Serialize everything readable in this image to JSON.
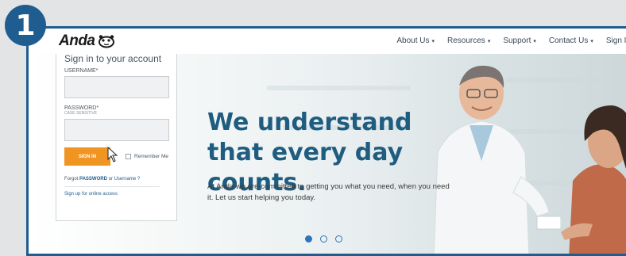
{
  "step": {
    "number": "1"
  },
  "nav": {
    "logo": "Anda",
    "items": [
      {
        "label": "About Us",
        "caret": "▾"
      },
      {
        "label": "Resources",
        "caret": "▾"
      },
      {
        "label": "Support",
        "caret": "▾"
      },
      {
        "label": "Contact Us",
        "caret": "▾"
      }
    ],
    "signin": "Sign In"
  },
  "login": {
    "title": "Sign in to your account",
    "username_label": "USERNAME*",
    "username_value": "",
    "password_label": "PASSWORD*",
    "password_sub": "CASE SENSITIVE",
    "password_value": "",
    "button": "SIGN IN",
    "remember": "Remember Me",
    "forgot_prefix": "Forgot ",
    "forgot_password": "PASSWORD",
    "forgot_or": " or ",
    "forgot_username": "Username ?",
    "signup": "Sign up for online access"
  },
  "hero": {
    "headline": "We understand that every day counts.",
    "subtext": "At Anda we are committed to getting you what you need, when you need it. Let us start helping you today."
  },
  "carousel": {
    "count": 3,
    "active": 0
  },
  "colors": {
    "accent": "#1f5d90",
    "button": "#f09422",
    "headline": "#1f5d80"
  }
}
